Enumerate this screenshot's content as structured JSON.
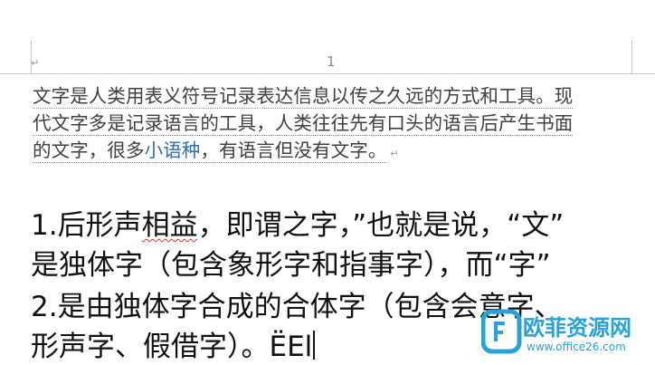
{
  "header": {
    "page_number": "1",
    "return_symbol": "↵"
  },
  "paragraph_small": {
    "line1": "文字是人类用表义符号记录表达信息以传之久远的方式和工具。现",
    "line2": "代文字多是记录语言的工具，人类往往先有口头的语言后产生书面",
    "line3_before": "的文字，很多",
    "line3_link": "小语种",
    "line3_after": "，有语言但没有文字。",
    "return_symbol": "↵"
  },
  "paragraph_large": {
    "line1_prefix": "1.后形声",
    "line1_flagged": "相益",
    "line1_rest": "，即谓之字，”也就是说，“文”",
    "line2": "是独体字（包含象形字和指事字），而“字”",
    "line3": "2.是由独体字合成的合体字（包含会意字、",
    "line4": "形声字、假借字）。ËEl"
  },
  "watermark": {
    "title": "欧菲资源网",
    "url": "www.office26.com"
  },
  "colors": {
    "link": "#2f6fb3",
    "watermark": "#27a3d9",
    "spellcheck": "#d03a3a"
  }
}
